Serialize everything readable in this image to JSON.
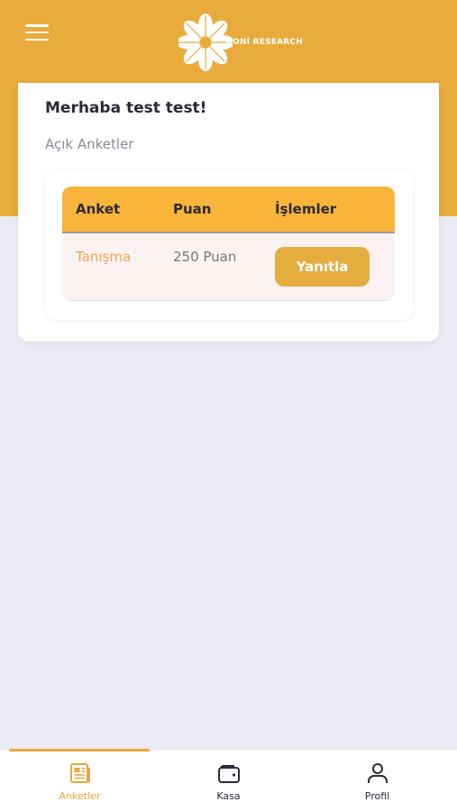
{
  "header": {
    "logo_text": "RONİ RESEARCH",
    "accent_color": "#e8ab3c"
  },
  "card": {
    "greeting": "Merhaba test test!",
    "section_title": "Açık Anketler"
  },
  "table": {
    "columns": [
      "Anket",
      "Puan",
      "İşlemler"
    ],
    "rows": [
      {
        "name": "Tanışma",
        "points": "250 Puan",
        "action": "Yanıtla"
      }
    ]
  },
  "bottom_nav": {
    "items": [
      {
        "label": "Anketler",
        "icon": "newspaper-icon",
        "active": true
      },
      {
        "label": "Kasa",
        "icon": "wallet-icon",
        "active": false
      },
      {
        "label": "Profil",
        "icon": "user-icon",
        "active": false
      }
    ]
  }
}
